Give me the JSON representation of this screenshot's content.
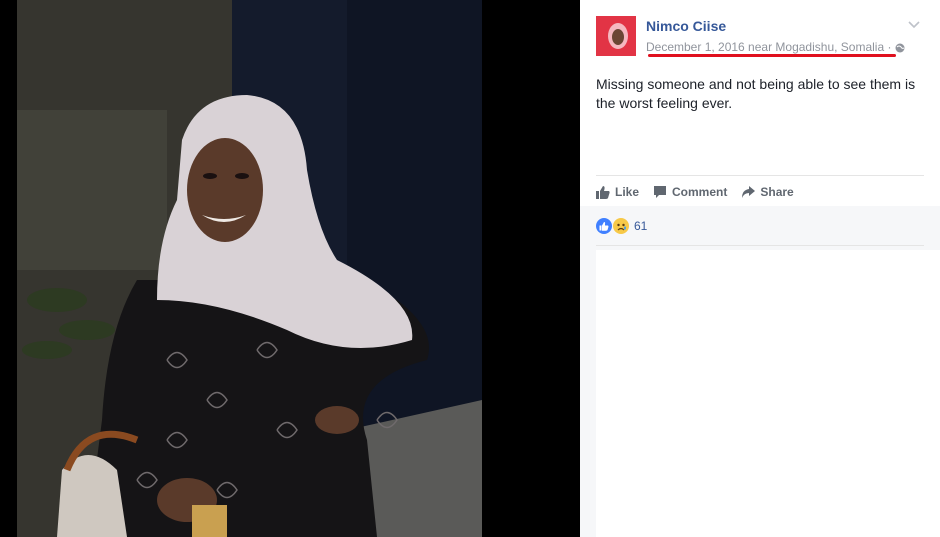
{
  "post": {
    "author": "Nimco Ciise",
    "meta": "December 1, 2016 near Mogadishu, Somalia · ",
    "text": "Missing someone and not being able to see them is the worst feeling ever."
  },
  "actions": {
    "like": "Like",
    "comment": "Comment",
    "share": "Share"
  },
  "reactions": {
    "count": "61"
  },
  "colors": {
    "link": "#365899",
    "underline": "#e0101e",
    "like": "#4080ff",
    "sad": "#f7c948"
  },
  "icons": [
    "chevron-down-icon",
    "globe-icon",
    "thumbs-up-icon",
    "comment-icon",
    "share-icon",
    "like-reaction-icon",
    "sad-reaction-icon"
  ]
}
